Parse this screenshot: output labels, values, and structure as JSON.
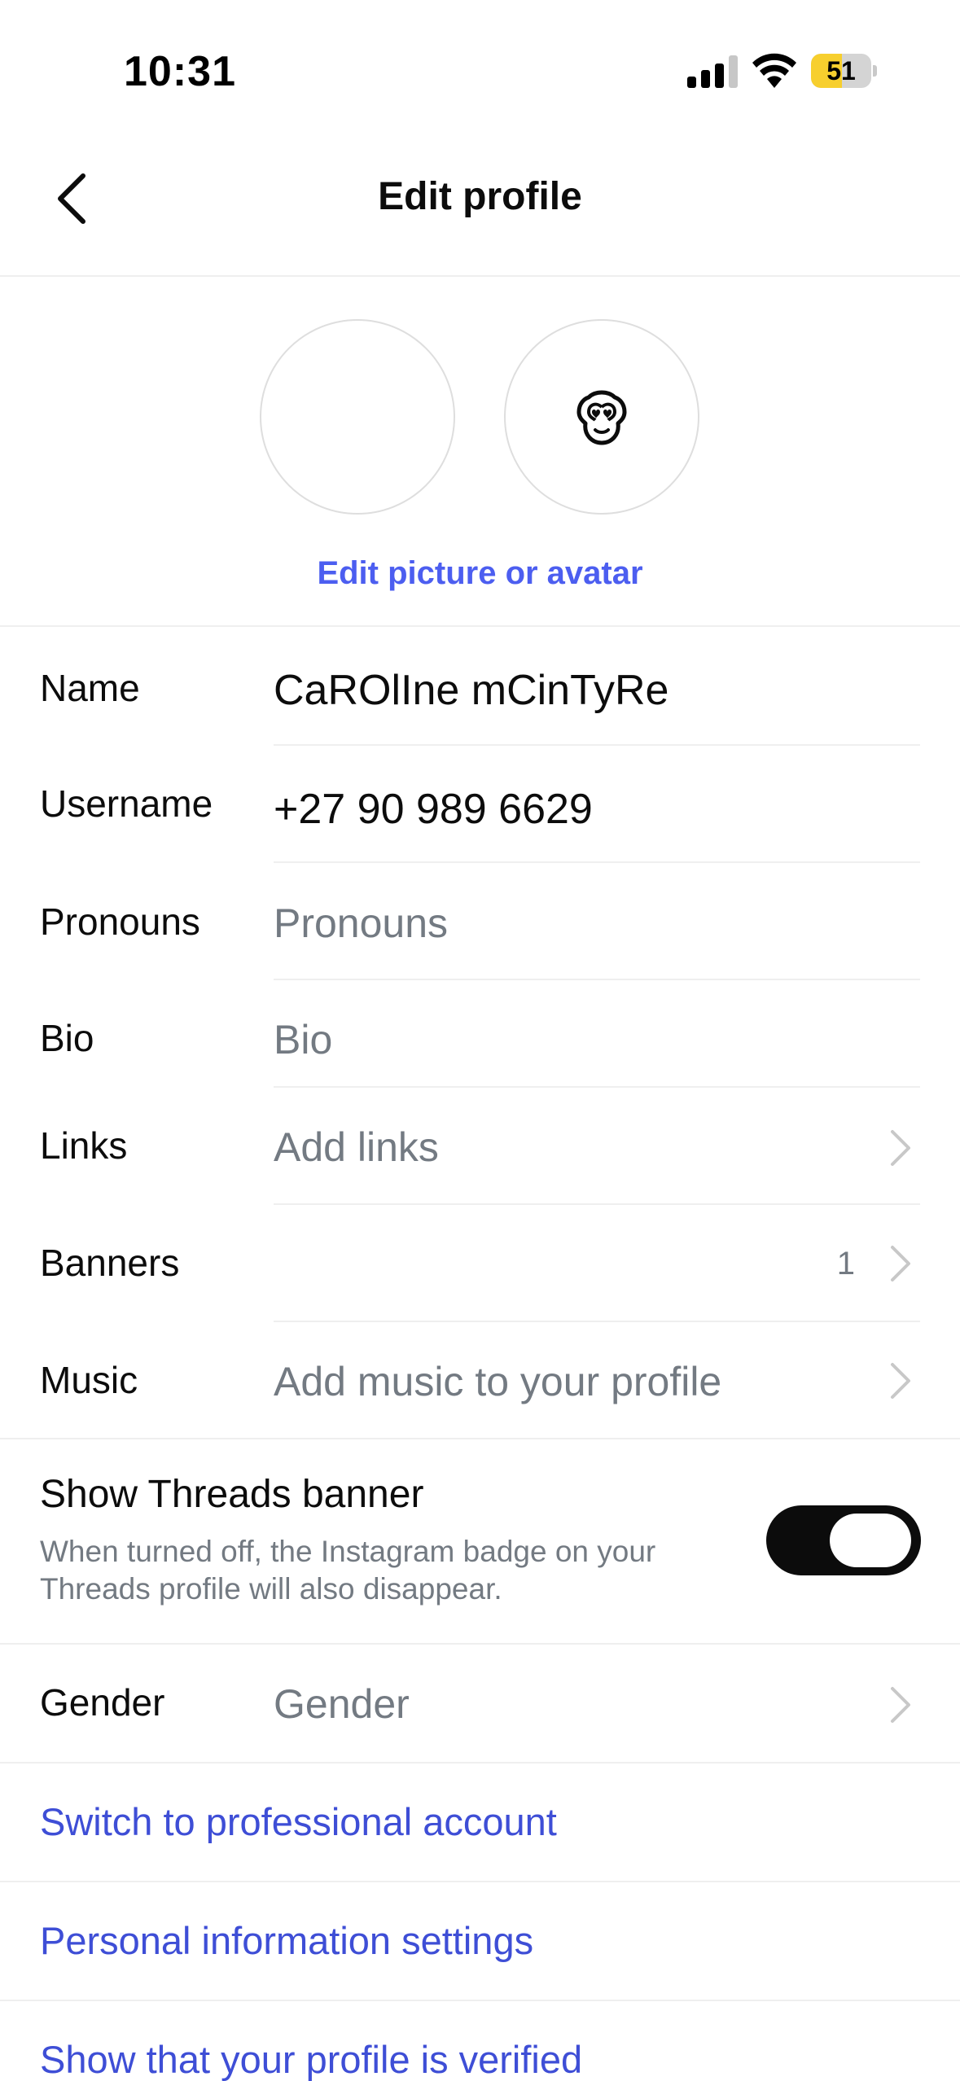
{
  "status_bar": {
    "time": "10:31",
    "battery_percent": "51",
    "battery_level": 0.51,
    "signal_icon": "cellular-signal-icon",
    "wifi_icon": "wifi-icon"
  },
  "header": {
    "title": "Edit profile",
    "back_icon": "chevron-left-icon"
  },
  "avatar": {
    "edit_label": "Edit picture or avatar",
    "avatar_icon": "monkey-heart-eyes-icon"
  },
  "fields": {
    "name": {
      "label": "Name",
      "value": "CaROlIne mCinTyRe"
    },
    "username": {
      "label": "Username",
      "value": "+27 90 989 6629"
    },
    "pronouns": {
      "label": "Pronouns",
      "placeholder": "Pronouns"
    },
    "bio": {
      "label": "Bio",
      "placeholder": "Bio"
    },
    "links": {
      "label": "Links",
      "placeholder": "Add links"
    },
    "banners": {
      "label": "Banners",
      "count": "1"
    },
    "music": {
      "label": "Music",
      "placeholder": "Add music to your profile"
    },
    "gender": {
      "label": "Gender",
      "placeholder": "Gender"
    }
  },
  "threads_banner": {
    "title": "Show Threads banner",
    "description": "When turned off, the Instagram badge on your Threads profile will also disappear.",
    "enabled": true
  },
  "links": {
    "professional": "Switch to professional account",
    "personal_info": "Personal information settings",
    "verified": "Show that your profile is verified"
  },
  "colors": {
    "accent_blue": "#4c5ef0",
    "link_blue": "#3e4ed6",
    "placeholder_gray": "#737a82",
    "toggle_on": "#0c0c0c"
  }
}
